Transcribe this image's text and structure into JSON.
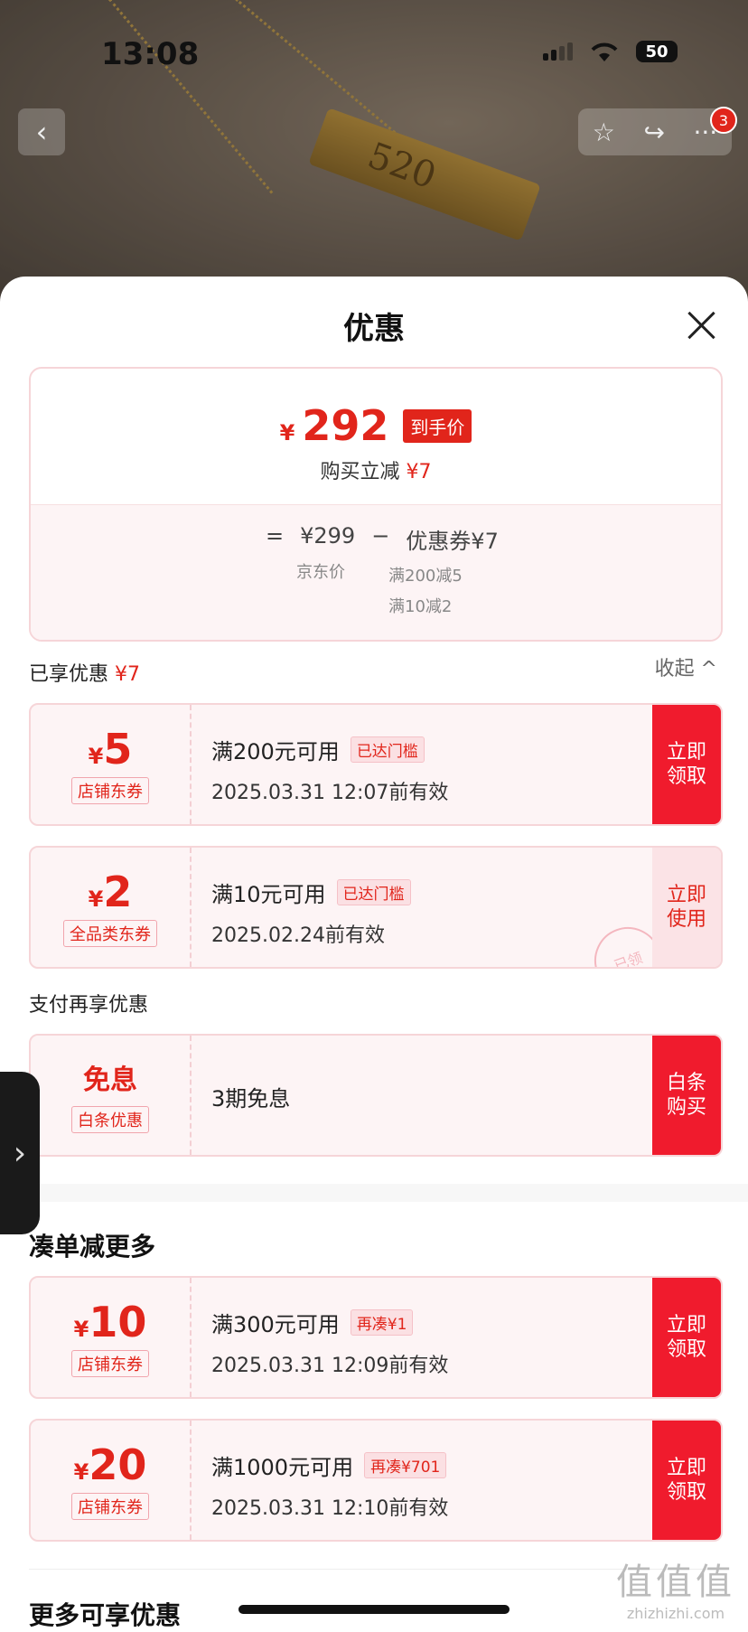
{
  "status_bar": {
    "time": "13:08",
    "battery": "50"
  },
  "top_nav": {
    "back_icon": "chevron-left-icon",
    "cart_badge": "3"
  },
  "product_photo": {
    "engraving": "520"
  },
  "sheet": {
    "title": "优惠",
    "price_summary": {
      "currency": "¥",
      "final_price": "292",
      "final_tag": "到手价",
      "discount_text": "购买立减",
      "discount_amount": "¥7",
      "equals": "=",
      "jd_price": "¥299",
      "jd_price_label": "京东价",
      "minus": "−",
      "coupon_total": "优惠券¥7",
      "coupon_rule_1": "满200减5",
      "coupon_rule_2": "满10减2"
    },
    "enjoyed": {
      "label": "已享优惠",
      "amount": "¥7",
      "collapse_label": "收起 ^"
    },
    "enjoyed_coupons": [
      {
        "currency": "¥",
        "amount": "5",
        "type": "店铺东券",
        "condition": "满200元可用",
        "badge": "已达门槛",
        "validity": "2025.03.31 12:07前有效",
        "button": "立即领取"
      },
      {
        "currency": "¥",
        "amount": "2",
        "type": "全品类东券",
        "condition": "满10元可用",
        "badge": "已达门槛",
        "validity": "2025.02.24前有效",
        "button": "立即使用",
        "stamp": "已领"
      }
    ],
    "payment": {
      "label": "支付再享优惠",
      "title": "免息",
      "type": "白条优惠",
      "description": "3期免息",
      "button": "白条购买"
    },
    "more_section": {
      "title": "凑单减更多"
    },
    "more_coupons": [
      {
        "currency": "¥",
        "amount": "10",
        "type": "店铺东券",
        "condition": "满300元可用",
        "badge": "再凑¥1",
        "validity": "2025.03.31 12:09前有效",
        "button": "立即领取"
      },
      {
        "currency": "¥",
        "amount": "20",
        "type": "店铺东券",
        "condition": "满1000元可用",
        "badge": "再凑¥701",
        "validity": "2025.03.31 12:10前有效",
        "button": "立即领取"
      }
    ],
    "bottom_section": {
      "title": "更多可享优惠"
    }
  },
  "watermark": {
    "line1": "值值值",
    "line2": "zhizhizhi.com"
  },
  "colors": {
    "accent": "#e1251b",
    "button_red": "#f01b2d",
    "coupon_bg": "#fdf4f5"
  }
}
